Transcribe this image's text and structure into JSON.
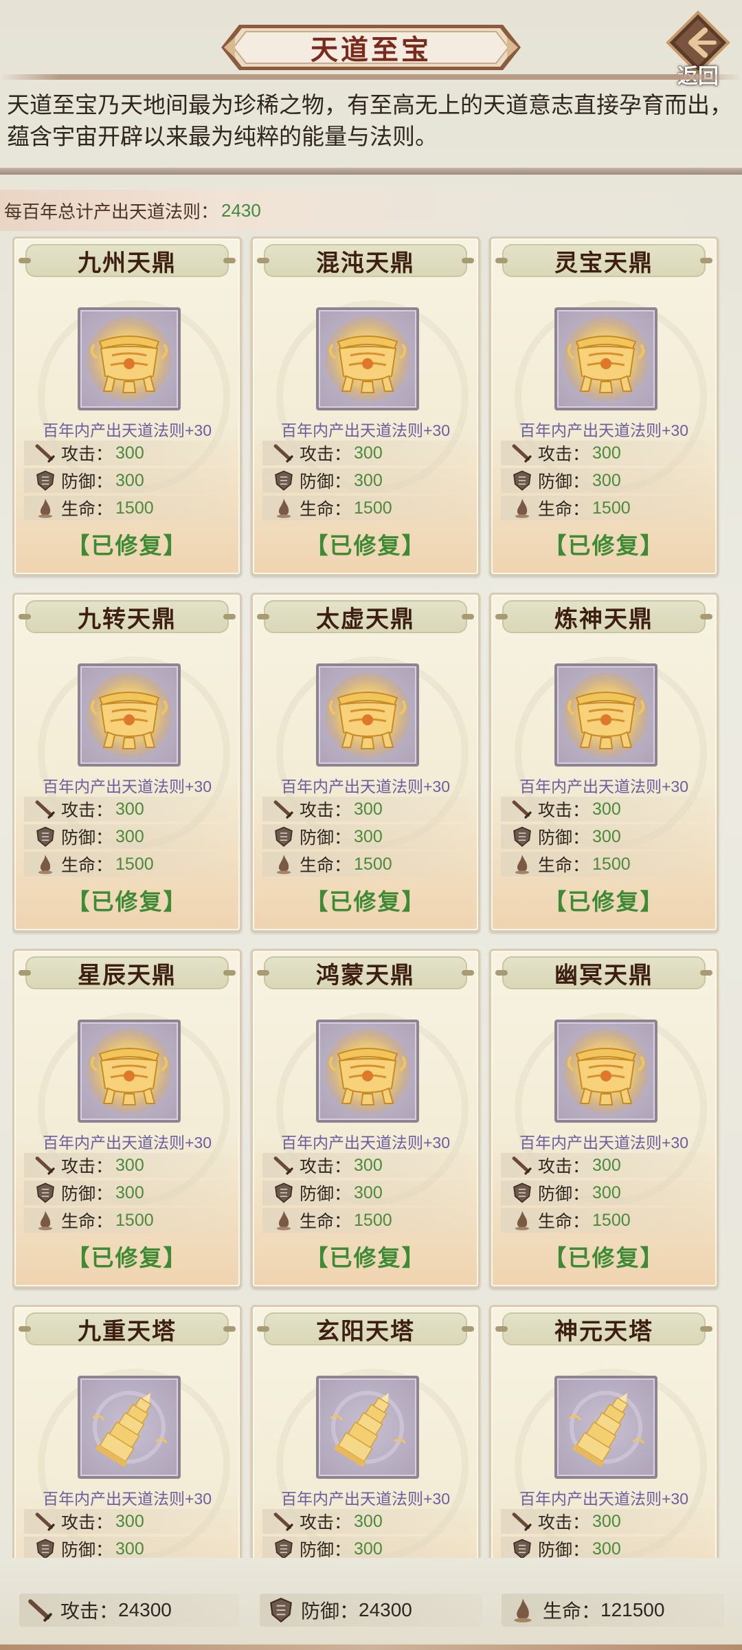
{
  "header": {
    "title": "天道至宝",
    "back_label": "返回"
  },
  "description": "天道至宝乃天地间最为珍稀之物，有至高无上的天道意志直接孕育而出，蕴含宇宙开辟以来最为纯粹的能量与法则。",
  "summary": {
    "label": "每百年总计产出天道法则：",
    "value": "2430"
  },
  "labels": {
    "attack": "攻击：",
    "defense": "防御：",
    "life": "生命："
  },
  "treasures": [
    {
      "name": "九州天鼎",
      "kind": "cauldron",
      "production": "百年内产出天道法则+30",
      "attack": "300",
      "defense": "300",
      "life": "1500",
      "status": "【已修复】"
    },
    {
      "name": "混沌天鼎",
      "kind": "cauldron",
      "production": "百年内产出天道法则+30",
      "attack": "300",
      "defense": "300",
      "life": "1500",
      "status": "【已修复】"
    },
    {
      "name": "灵宝天鼎",
      "kind": "cauldron",
      "production": "百年内产出天道法则+30",
      "attack": "300",
      "defense": "300",
      "life": "1500",
      "status": "【已修复】"
    },
    {
      "name": "九转天鼎",
      "kind": "cauldron",
      "production": "百年内产出天道法则+30",
      "attack": "300",
      "defense": "300",
      "life": "1500",
      "status": "【已修复】"
    },
    {
      "name": "太虚天鼎",
      "kind": "cauldron",
      "production": "百年内产出天道法则+30",
      "attack": "300",
      "defense": "300",
      "life": "1500",
      "status": "【已修复】"
    },
    {
      "name": "炼神天鼎",
      "kind": "cauldron",
      "production": "百年内产出天道法则+30",
      "attack": "300",
      "defense": "300",
      "life": "1500",
      "status": "【已修复】"
    },
    {
      "name": "星辰天鼎",
      "kind": "cauldron",
      "production": "百年内产出天道法则+30",
      "attack": "300",
      "defense": "300",
      "life": "1500",
      "status": "【已修复】"
    },
    {
      "name": "鸿蒙天鼎",
      "kind": "cauldron",
      "production": "百年内产出天道法则+30",
      "attack": "300",
      "defense": "300",
      "life": "1500",
      "status": "【已修复】"
    },
    {
      "name": "幽冥天鼎",
      "kind": "cauldron",
      "production": "百年内产出天道法则+30",
      "attack": "300",
      "defense": "300",
      "life": "1500",
      "status": "【已修复】"
    },
    {
      "name": "九重天塔",
      "kind": "tower",
      "production": "百年内产出天道法则+30",
      "attack": "300",
      "defense": "300",
      "life": "",
      "status": ""
    },
    {
      "name": "玄阳天塔",
      "kind": "tower",
      "production": "百年内产出天道法则+30",
      "attack": "300",
      "defense": "300",
      "life": "",
      "status": ""
    },
    {
      "name": "神元天塔",
      "kind": "tower",
      "production": "百年内产出天道法则+30",
      "attack": "300",
      "defense": "300",
      "life": "",
      "status": ""
    }
  ],
  "totals": {
    "attack_label": "攻击：",
    "attack_value": "24300",
    "defense_label": "防御：",
    "defense_value": "24300",
    "life_label": "生命：",
    "life_value": "121500"
  },
  "icons": {
    "back": "back-arrow-icon",
    "attack": "sword-icon",
    "defense": "shield-icon",
    "life": "flame-icon",
    "cauldron": "golden-cauldron-icon",
    "tower": "golden-pagoda-icon"
  },
  "colors": {
    "title_text": "#7a2b1c",
    "stat_value": "#4a8a3a",
    "repaired_status": "#3e8a35",
    "production_text": "#6a5fa0"
  }
}
